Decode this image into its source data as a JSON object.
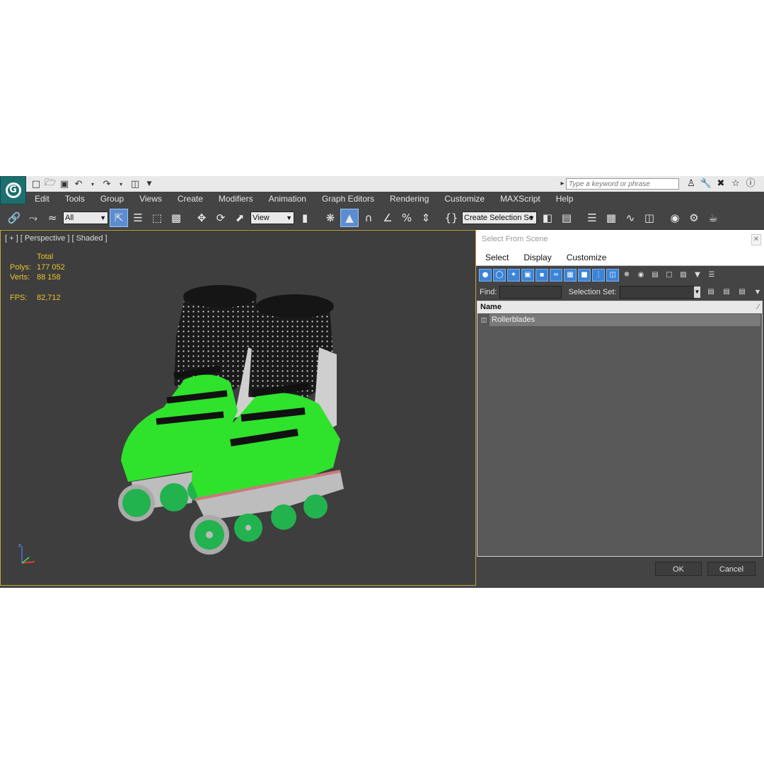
{
  "title_bar": {
    "logo_letter": "G",
    "search_placeholder": "Type a keyword or phrase",
    "quick_access_icons": [
      "new-file-icon",
      "open-folder-icon",
      "save-icon",
      "undo-icon",
      "redo-icon",
      "project-icon"
    ],
    "info_icons": [
      "binoculars-icon",
      "wrench-icon",
      "exchange-icon",
      "star-icon",
      "help-icon"
    ]
  },
  "menu": {
    "items": [
      "Edit",
      "Tools",
      "Group",
      "Views",
      "Create",
      "Modifiers",
      "Animation",
      "Graph Editors",
      "Rendering",
      "Customize",
      "MAXScript",
      "Help"
    ]
  },
  "toolbar": {
    "filter_value": "All",
    "coord_value": "View",
    "selection_set_value": "Create Selection Se"
  },
  "viewport": {
    "label": "[ + ] [ Perspective ] [ Shaded ]",
    "stats": {
      "total_label": "Total",
      "polys_label": "Polys:",
      "polys_value": "177 052",
      "verts_label": "Verts:",
      "verts_value": "88 158",
      "fps_label": "FPS:",
      "fps_value": "82,712"
    },
    "gizmo_axis": "z"
  },
  "dialog": {
    "title": "Select From Scene",
    "menu": [
      "Select",
      "Display",
      "Customize"
    ],
    "find_label": "Find:",
    "selection_set_label": "Selection Set:",
    "column_name": "Name",
    "rows": [
      "Rollerblades"
    ],
    "ok_label": "OK",
    "cancel_label": "Cancel"
  },
  "colors": {
    "accent_blue": "#3b84d8",
    "viewport_border": "#c9a23a",
    "stats_text": "#e8c22d",
    "model_green": "#2fe22c"
  }
}
